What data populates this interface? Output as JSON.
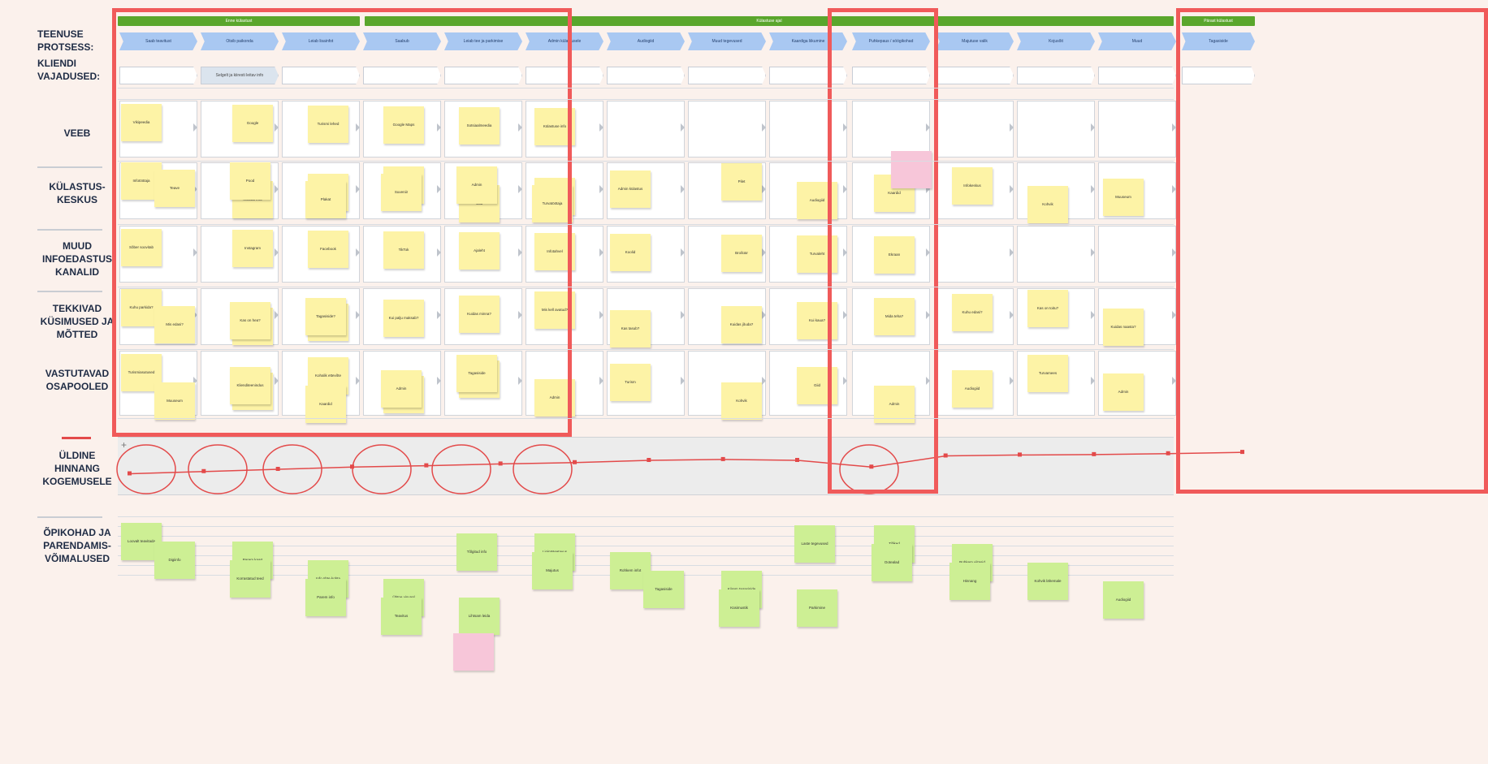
{
  "rows": {
    "process": "TEENUSE\nPROTSESS:",
    "needs": "KLIENDI\nVAJADUSED:",
    "web": "VEEB",
    "visitor_center": "KÜLASTUS-\nKESKUS",
    "other_channels": "MUUD\nINFOEDASTUS\nKANALID",
    "questions": "TEKKIVAD\nKÜSIMUSED JA\nMÕTTED",
    "parties": "VASTUTAVAD\nOSAPOOLED",
    "experience": "ÜLDINE\nHINNANG\nKOGEMUSELE",
    "lessons": "ÕPIKOHAD JA\nPARENDAMIS-\nVÕIMALUSED"
  },
  "phases": [
    "Enne külastust",
    "Külastuse ajal",
    "Pärast külastust"
  ],
  "steps": [
    "Saab teavitust",
    "Otsib paikonda",
    "Leiab lisainfot",
    "Saabub",
    "Leiab tee ja parkimise",
    "Admin külastusele",
    "Audiogiid",
    "Muud tegevused",
    "Kaardiga liikumine",
    "Puhkepaus / söögikohad",
    "Majutuse valik",
    "Kojusõit",
    "Muud",
    "Tagasiside"
  ],
  "need_note": "Selgelt ja kiiresti leitav info",
  "colors": {
    "background": "#fbf1ec",
    "phase": "#5aa62c",
    "step": "#a9c8f2",
    "sticky_yellow": "#fdf3a6",
    "sticky_green": "#cdef94",
    "sticky_pink": "#f7c6d9",
    "highlight": "#f05a5a"
  },
  "stickies": {
    "web": [
      "Vikipeedia",
      "Google",
      "Turismi lehed",
      "Google Maps",
      "Sotsiaalmeedia",
      "Külastuse info"
    ],
    "visitor_center": [
      "Infotöötaja",
      "Kohalik info",
      "Kaart",
      "Avalikud tegevused",
      "Giid",
      "Admin",
      "Admin külastus",
      "Pilet",
      "Audiogiid",
      "Kaardid",
      "Infokeskus",
      "Kohvik",
      "Muuseum",
      "Teave",
      "Pood",
      "Plakat",
      "Suveniir",
      "Admin",
      "Turvatöötaja"
    ],
    "other": [
      "Sõber soovitab",
      "Instagram",
      "Facebook",
      "TikTok",
      "Ajaleht",
      "Infotahvel",
      "Koolid",
      "Brošüür",
      "Turvaleht",
      "Ekraan"
    ],
    "questions": [
      "Kuhu parkida?",
      "Kas on piletid?",
      "Kuidas leida?",
      "Kui palju maksab?",
      "Kuidas minna?",
      "Mis kell avatud?",
      "Kas tasub?",
      "Kuidas jõuda?",
      "Kui kaua?",
      "Mida teha?",
      "Kuhu edasi?",
      "Kas on toitu?",
      "Kuidas naasta?",
      "Mis edasi?",
      "Kas on hea?",
      "Tagasiside?"
    ],
    "parties": [
      "Turismiasutused",
      "Omavalitsus",
      "Kohalik ettevõte",
      "Pargid",
      "Transport",
      "Admin",
      "Turism",
      "Kohvik",
      "Giid",
      "Admin",
      "Audiogiid",
      "Turvamees",
      "Admin",
      "Muuseum",
      "Klienditeenindus",
      "Kaardid",
      "Admin",
      "Tagasiside"
    ],
    "lessons": [
      "Loovalt teavitada",
      "Parem kaart",
      "Info ühte kohta",
      "Ühtne visuaal",
      "Lihtsam leida",
      "Ligipääsetavus",
      "Rohkem infot",
      "Kiirem tagasiside",
      "Parkimine",
      "Tõlked",
      "Rohkem viitasid",
      "Kohvik lähemale",
      "Audiogiid",
      "Digiinfo",
      "Korrastatud teed",
      "Parem info",
      "Teavitus",
      "Tõlgitud info",
      "Majutus",
      "Tagasiside",
      "Küsimustik",
      "Laste tegevused",
      "Ootealad",
      "Hinnang"
    ]
  },
  "experience_values": [
    0.3,
    0.35,
    0.4,
    0.45,
    0.48,
    0.52,
    0.55,
    0.6,
    0.62,
    0.6,
    0.45,
    0.7,
    0.72,
    0.73,
    0.75,
    0.78
  ]
}
